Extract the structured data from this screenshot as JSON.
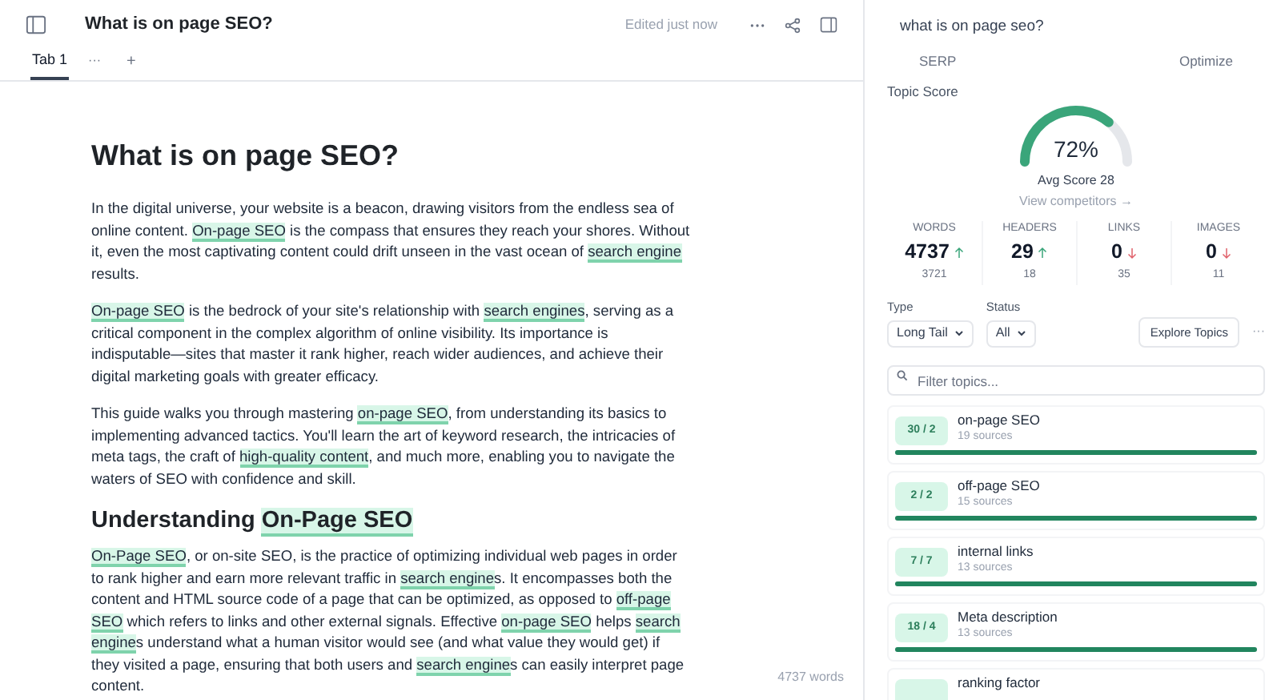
{
  "document": {
    "title": "What is on page SEO?",
    "status": "Edited just now"
  },
  "tabs": [
    {
      "label": "Tab 1",
      "selected": true,
      "more": "···"
    }
  ],
  "add_tab": "+",
  "article": [
    {
      "kind": "h1",
      "segments": [
        {
          "text": "What is on page SEO?",
          "keyword": false
        }
      ]
    },
    {
      "kind": "p",
      "segments": [
        {
          "text": "In the digital universe, your website is a beacon, drawing visitors from the endless sea of online content. ",
          "keyword": false
        },
        {
          "text": "On-page SEO",
          "keyword": true
        },
        {
          "text": " is the compass that ensures they reach your shores. Without it, even the most captivating content could drift unseen in the vast ocean of ",
          "keyword": false
        },
        {
          "text": "search engine",
          "keyword": true
        },
        {
          "text": " results.",
          "keyword": false
        }
      ]
    },
    {
      "kind": "p",
      "segments": [
        {
          "text": "On-page SEO",
          "keyword": true
        },
        {
          "text": " is the bedrock of your site's relationship with ",
          "keyword": false
        },
        {
          "text": "search engines",
          "keyword": true
        },
        {
          "text": ", serving as a critical component in the complex algorithm of online visibility. Its importance is indisputable—sites that master it rank higher, reach wider audiences, and achieve their digital marketing goals with greater efficacy.",
          "keyword": false
        }
      ]
    },
    {
      "kind": "p",
      "segments": [
        {
          "text": "This guide walks you through mastering ",
          "keyword": false
        },
        {
          "text": "on-page SEO",
          "keyword": true
        },
        {
          "text": ", from understanding its basics to implementing advanced tactics. You'll learn the art of keyword research, the intricacies of meta tags, the craft of ",
          "keyword": false
        },
        {
          "text": "high-quality content",
          "keyword": true
        },
        {
          "text": ", and much more, enabling you to navigate the waters of SEO with confidence and skill.",
          "keyword": false
        }
      ]
    },
    {
      "kind": "h2",
      "segments": [
        {
          "text": "Understanding ",
          "keyword": false
        },
        {
          "text": "On-Page SEO",
          "keyword": true
        }
      ]
    },
    {
      "kind": "p",
      "segments": [
        {
          "text": "On-Page SEO",
          "keyword": true
        },
        {
          "text": ", or on-site SEO, is the practice of optimizing individual web pages in order to rank higher and earn more relevant traffic in ",
          "keyword": false
        },
        {
          "text": "search engine",
          "keyword": true
        },
        {
          "text": "s. It encompasses both the content and HTML source code of a page that can be optimized, as opposed to ",
          "keyword": false
        },
        {
          "text": "off-page SEO",
          "keyword": true
        },
        {
          "text": " which refers to links and other external signals. Effective ",
          "keyword": false
        },
        {
          "text": "on-page SEO",
          "keyword": true
        },
        {
          "text": " helps ",
          "keyword": false
        },
        {
          "text": "search engine",
          "keyword": true
        },
        {
          "text": "s understand what a human visitor would see (and what value they would get) if they visited a page, ensuring that both users and ",
          "keyword": false
        },
        {
          "text": "search engine",
          "keyword": true
        },
        {
          "text": "s can easily interpret page content.",
          "keyword": false
        }
      ]
    }
  ],
  "word_count": "4737 words",
  "panel": {
    "query": "what is on page seo?",
    "tabs": [
      {
        "label": "SERP"
      },
      {
        "label": "Optimize"
      }
    ],
    "topic_score": {
      "label": "Topic Score",
      "value": "72%",
      "level": 0.72,
      "avg": "Avg Score 28",
      "link": "View competitors →"
    },
    "stats": [
      {
        "label": "WORDS",
        "value": "4737",
        "rising": true,
        "target": "3721"
      },
      {
        "label": "HEADERS",
        "value": "29",
        "rising": true,
        "target": "18"
      },
      {
        "label": "LINKS",
        "value": "0",
        "rising": false,
        "target": "35"
      },
      {
        "label": "IMAGES",
        "value": "0",
        "rising": false,
        "target": "11"
      }
    ],
    "filters": [
      {
        "label": "Type",
        "value": "Long Tail"
      },
      {
        "label": "Status",
        "value": "All"
      }
    ],
    "explore_button": "Explore Topics",
    "more": "···",
    "search": {
      "placeholder": "Filter topics..."
    },
    "topics": [
      {
        "score": "30 / 2",
        "name": "on-page SEO",
        "sources": "19 sources",
        "level": 1
      },
      {
        "score": "2 / 2",
        "name": "off-page SEO",
        "sources": "15 sources",
        "level": 1
      },
      {
        "score": "7 / 7",
        "name": "internal links",
        "sources": "13 sources",
        "level": 1
      },
      {
        "score": "18 / 4",
        "name": "Meta description",
        "sources": "13 sources",
        "level": 1
      },
      {
        "name": "ranking factor"
      }
    ]
  }
}
